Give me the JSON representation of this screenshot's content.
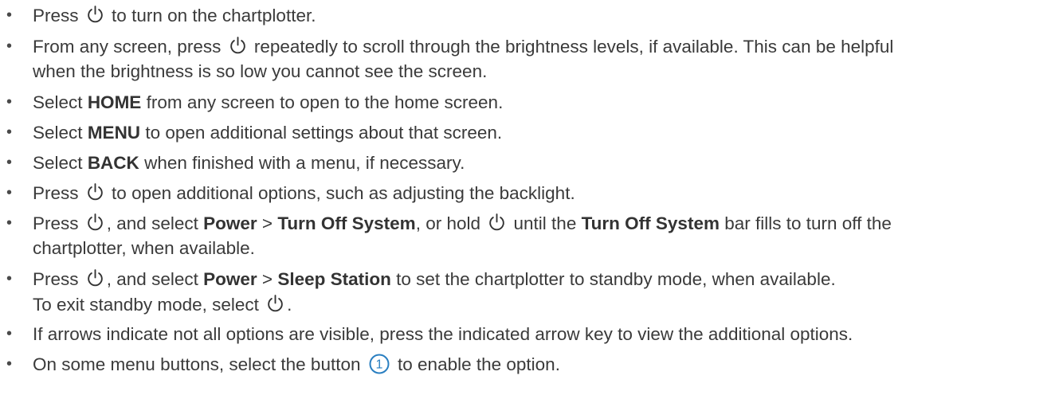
{
  "bullet_symbol": "•",
  "power_icon": "power-icon",
  "callout_icon": "callout-number-icon",
  "callout_number": "1",
  "accent_color": "#2a7fc1",
  "items": [
    {
      "pre": "Press",
      "post": "to turn on the chartplotter."
    },
    {
      "pre": "From any screen, press",
      "post": "repeatedly to scroll through the brightness levels, if available. This can be helpful",
      "line2": "when the brightness is so low you cannot see the screen."
    },
    {
      "pre": "Select",
      "bold": "HOME",
      "post": "from any screen to open to the home screen."
    },
    {
      "pre": "Select",
      "bold": "MENU",
      "post": "to open additional settings about that screen."
    },
    {
      "pre": "Select",
      "bold": "BACK",
      "post": "when finished with a menu, if necessary."
    },
    {
      "pre": "Press",
      "post": "to open additional options, such as adjusting the backlight."
    },
    {
      "pre": "Press",
      "mid1": ", and select",
      "bold1": "Power",
      "sep": ">",
      "bold2": "Turn Off System",
      "mid2": ", or hold",
      "mid3": "until the",
      "bold3": "Turn Off System",
      "post": "bar fills to turn off the",
      "line2": "chartplotter, when available."
    },
    {
      "pre": "Press",
      "mid1": ", and select",
      "bold1": "Power",
      "sep": ">",
      "bold2": "Sleep Station",
      "post": "to set the chartplotter to standby mode, when available.",
      "line2": "To exit standby mode, select",
      "line2_end": "."
    },
    {
      "text": "If arrows indicate not all options are visible, press the indicated arrow key to view the additional options."
    },
    {
      "pre": "On some menu buttons, select the button",
      "post": "to enable the option."
    }
  ]
}
